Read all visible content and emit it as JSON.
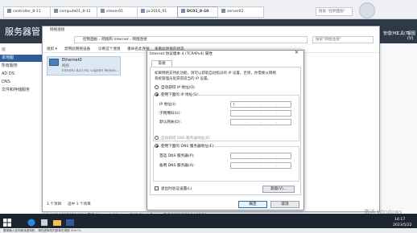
{
  "vm_tabs": [
    {
      "label": "controller_8-11"
    },
    {
      "label": "compute01_8-11"
    },
    {
      "label": "sliever01"
    },
    {
      "label": "pc2016_01"
    },
    {
      "label": "DC01_8-10",
      "active": true
    },
    {
      "label": "server02"
    }
  ],
  "vm_search_placeholder": "搜索 \"控制面板\"",
  "server_manager": {
    "title": "服务器管",
    "menu": {
      "manage": "管理(M)",
      "tools": "工具(T)",
      "view": "视图(V)"
    },
    "nav": [
      "仪",
      "本地服",
      "所有服务",
      "AD DS",
      "DNS",
      "文件和存储服务"
    ]
  },
  "net_window": {
    "title": "网络连接",
    "address": "控制面板 › 网络和 Internet › 网络连接",
    "search_placeholder": "搜索\"网络连接\"",
    "commands": [
      "组织 ▾",
      "禁用此网络设备",
      "诊断这个连接",
      "重命名此连接",
      "查看此连接的状态",
      "更改此连接的设置"
    ],
    "adapter": {
      "name": "Ethernet0",
      "status": "网络",
      "device": "Intel(R) 82574L Gigabit Netwo..."
    },
    "status": "1 个项目",
    "status2": "选中 1 个项目"
  },
  "event_row": "WIN-04SV4B3D6D1  1014  警告  Microsoft-Windows-DNS Client Events  系统  2023/5/22 14:17:50",
  "ipv4": {
    "title": "Internet 协议版本 4 (TCP/IPv4) 属性",
    "tab": "常规",
    "intro1": "如果网络支持此功能，则可以获取自动指派的 IP 设置。否则，你需要从网络",
    "intro2": "系统管理员处获得适当的 IP 设置。",
    "auto_ip": "自动获得 IP 地址(O)",
    "manual_ip": "使用下面的 IP 地址(S):",
    "ip_label": "IP 地址(I):",
    "mask_label": "子网掩码(U):",
    "gw_label": "默认网关(D):",
    "auto_dns": "自动获得 DNS 服务器地址(B)",
    "manual_dns": "使用下面的 DNS 服务器地址(E):",
    "dns1_label": "首选 DNS 服务器(P):",
    "dns2_label": "备用 DNS 服务器(A):",
    "validate": "退出时验证设置(L)",
    "advanced": "高级(V)...",
    "ok": "确定",
    "cancel": "取消"
  },
  "taskbar": {
    "time": "14:17",
    "date": "2023/5/22"
  },
  "watermark": "激活 Windows",
  "vm_status": "要将输入定向到该虚拟机，请在虚拟机内部单击或按 Ctrl+G。"
}
